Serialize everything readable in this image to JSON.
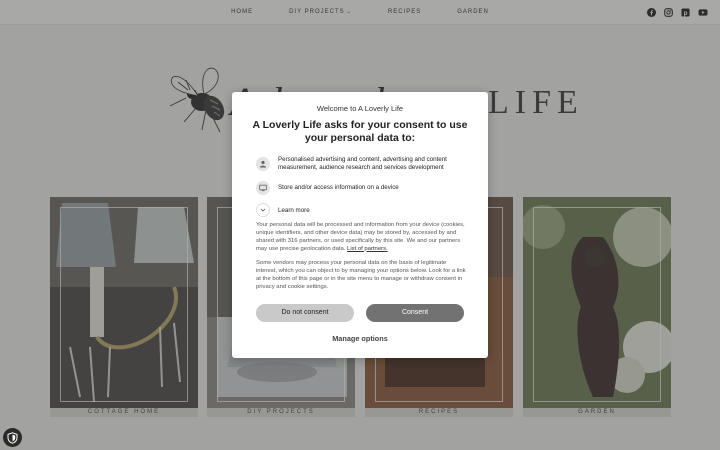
{
  "nav": {
    "items": [
      {
        "label": "HOME"
      },
      {
        "label": "DIY PROJECTS",
        "has_dropdown": true
      },
      {
        "label": "RECIPES"
      },
      {
        "label": "GARDEN"
      }
    ],
    "social": [
      "facebook-icon",
      "instagram-icon",
      "pinterest-icon",
      "youtube-icon"
    ]
  },
  "logo": {
    "life": "LIFE"
  },
  "tiles": [
    {
      "label": "COTTAGE HOME"
    },
    {
      "label": "DIY PROJECTS"
    },
    {
      "label": "RECIPES"
    },
    {
      "label": "GARDEN"
    }
  ],
  "consent": {
    "welcome": "Welcome to A Loverly Life",
    "heading": "A Loverly Life asks for your consent to use your personal data to:",
    "purposes": [
      {
        "icon": "person-icon",
        "text": "Personalised advertising and content, advertising and content measurement, audience research and services development"
      },
      {
        "icon": "device-icon",
        "text": "Store and/or access information on a device"
      }
    ],
    "learn_more": "Learn more",
    "para1": "Your personal data will be processed and information from your device (cookies, unique identifiers, and other device data) may be stored by, accessed by and shared with 316 partners, or used specifically by this site. We and our partners may use precise geolocation data.",
    "partners_link": "List of partners.",
    "para2": "Some vendors may process your personal data on the basis of legitimate interest, which you can object to by managing your options below. Look for a link at the bottom of this page or in the site menu to manage or withdraw consent in privacy and cookie settings.",
    "do_not_consent": "Do not consent",
    "consent": "Consent",
    "manage": "Manage options"
  },
  "colors": {
    "overlay": "#3c3c3c",
    "consent_button": "#727272",
    "reject_button": "#c9c9c9"
  }
}
